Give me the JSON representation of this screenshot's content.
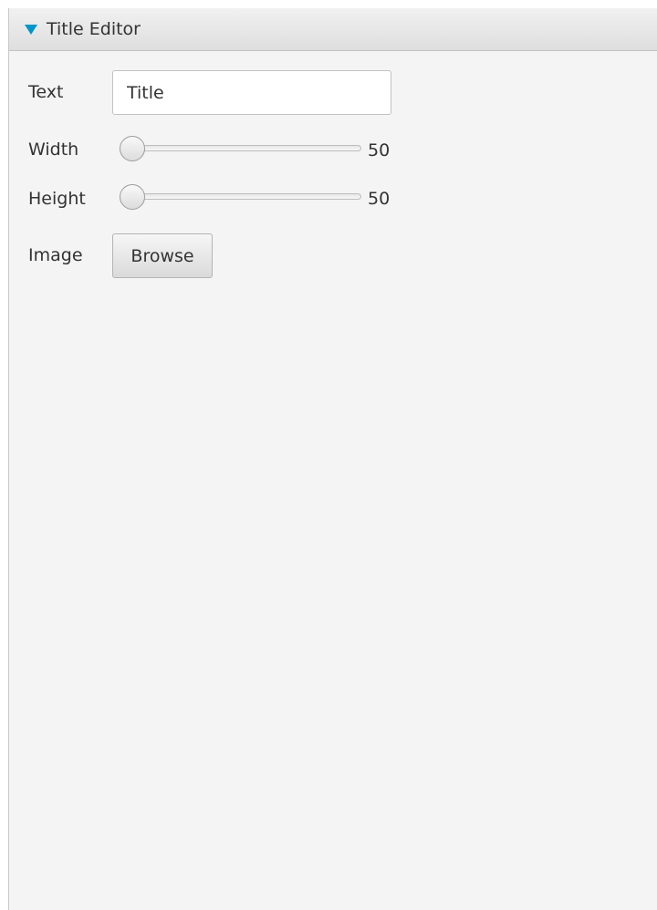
{
  "panel": {
    "title": "Title Editor",
    "expanded": true
  },
  "form": {
    "text": {
      "label": "Text",
      "value": "Title"
    },
    "width": {
      "label": "Width",
      "value": "50",
      "slider_fraction": 0.0
    },
    "height": {
      "label": "Height",
      "value": "50",
      "slider_fraction": 0.0
    },
    "image": {
      "label": "Image",
      "button_label": "Browse"
    }
  },
  "colors": {
    "accent": "#0096c9",
    "panel_background": "#f4f4f4"
  }
}
